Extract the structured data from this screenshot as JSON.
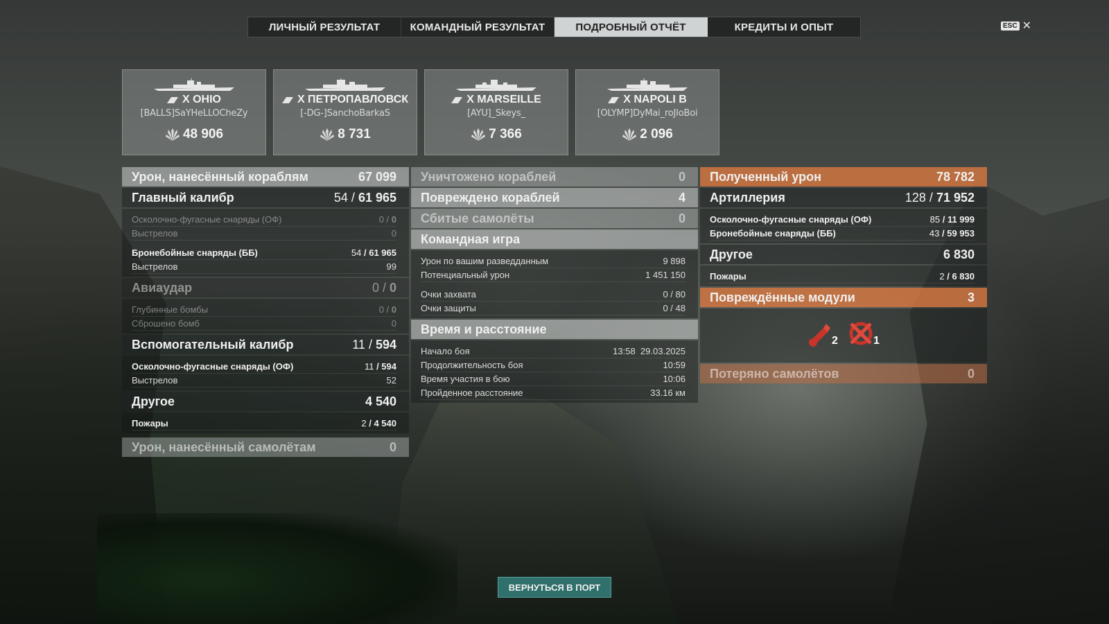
{
  "tabs": [
    {
      "label": "ЛИЧНЫЙ РЕЗУЛЬТАТ",
      "active": false
    },
    {
      "label": "КОМАНДНЫЙ РЕЗУЛЬТАТ",
      "active": false
    },
    {
      "label": "ПОДРОБНЫЙ ОТЧЁТ",
      "active": true
    },
    {
      "label": "КРЕДИТЫ И ОПЫТ",
      "active": false
    }
  ],
  "esc": {
    "badge": "ESC",
    "close": "✕"
  },
  "cards": [
    {
      "ship": "X OHIO",
      "player": "[BALLS]SaYHeLLOCheZy",
      "damage": "48 906"
    },
    {
      "ship": "X ПЕТРОПАВЛОВСК",
      "player": "[-DG-]SanchoBarkaS",
      "damage": "8 731"
    },
    {
      "ship": "X MARSEILLE",
      "player": "[AYU]_Skeys_",
      "damage": "7 366"
    },
    {
      "ship": "X NAPOLI B",
      "player": "[OLYMP]DyMai_roJIoBoi",
      "damage": "2 096"
    }
  ],
  "col1": {
    "ship_damage": {
      "label": "Урон, нанесённый кораблям",
      "value": "67 099"
    },
    "main_battery": {
      "label": "Главный калибр",
      "hits": "54",
      "dmg": "61 965"
    },
    "main_he": {
      "label": "Осколочно-фугасные снаряды (ОФ)",
      "hits": "0",
      "dmg": "0"
    },
    "main_he_shots": {
      "label": "Выстрелов",
      "value": "0"
    },
    "main_ap": {
      "label": "Бронебойные снаряды (ББ)",
      "hits": "54",
      "dmg": "61 965"
    },
    "main_ap_shots": {
      "label": "Выстрелов",
      "value": "99"
    },
    "airstrike": {
      "label": "Авиаудар",
      "hits": "0",
      "dmg": "0"
    },
    "depth_charges": {
      "label": "Глубинные бомбы",
      "hits": "0",
      "dmg": "0"
    },
    "bombs_dropped": {
      "label": "Сброшено бомб",
      "value": "0"
    },
    "secondary": {
      "label": "Вспомогательный калибр",
      "hits": "11",
      "dmg": "594"
    },
    "sec_he": {
      "label": "Осколочно-фугасные снаряды (ОФ)",
      "hits": "11",
      "dmg": "594"
    },
    "sec_shots": {
      "label": "Выстрелов",
      "value": "52"
    },
    "other": {
      "label": "Другое",
      "value": "4 540"
    },
    "fires": {
      "label": "Пожары",
      "hits": "2",
      "dmg": "4 540"
    },
    "plane_damage": {
      "label": "Урон, нанесённый самолётам",
      "value": "0"
    }
  },
  "col2": {
    "destroyed": {
      "label": "Уничтожено кораблей",
      "value": "0"
    },
    "damaged": {
      "label": "Повреждено кораблей",
      "value": "4"
    },
    "planes_shot": {
      "label": "Сбитые самолёты",
      "value": "0"
    },
    "teamplay": {
      "label": "Командная игра"
    },
    "spotting": {
      "label": "Урон по вашим разведданным",
      "value": "9 898"
    },
    "potential": {
      "label": "Потенциальный урон",
      "value": "1 451 150"
    },
    "capture": {
      "label": "Очки захвата",
      "value": "0 / 80"
    },
    "defense": {
      "label": "Очки защиты",
      "value": "0 / 48"
    },
    "time_distance": {
      "label": "Время и расстояние"
    },
    "battle_start": {
      "label": "Начало боя",
      "value": "13:58  29.03.2025"
    },
    "battle_duration": {
      "label": "Продолжительность боя",
      "value": "10:59"
    },
    "time_in_battle": {
      "label": "Время участия в бою",
      "value": "10:06"
    },
    "distance": {
      "label": "Пройденное расстояние",
      "value": "33.16 км"
    }
  },
  "col3": {
    "received": {
      "label": "Полученный урон",
      "value": "78 782"
    },
    "artillery": {
      "label": "Артиллерия",
      "hits": "128",
      "dmg": "71 952"
    },
    "art_he": {
      "label": "Осколочно-фугасные снаряды (ОФ)",
      "hits": "85",
      "dmg": "11 999"
    },
    "art_ap": {
      "label": "Бронебойные снаряды (ББ)",
      "hits": "43",
      "dmg": "59 953"
    },
    "other": {
      "label": "Другое",
      "value": "6 830"
    },
    "fires": {
      "label": "Пожары",
      "hits": "2",
      "dmg": "6 830"
    },
    "modules": {
      "label": "Повреждённые модули",
      "value": "3"
    },
    "module_items": [
      {
        "icon": "torpedo-tube-icon",
        "count": "2"
      },
      {
        "icon": "steering-gear-icon",
        "count": "1"
      }
    ],
    "planes_lost": {
      "label": "Потеряно самолётов",
      "value": "0"
    }
  },
  "back_button": "ВЕРНУТЬСЯ В ПОРТ"
}
